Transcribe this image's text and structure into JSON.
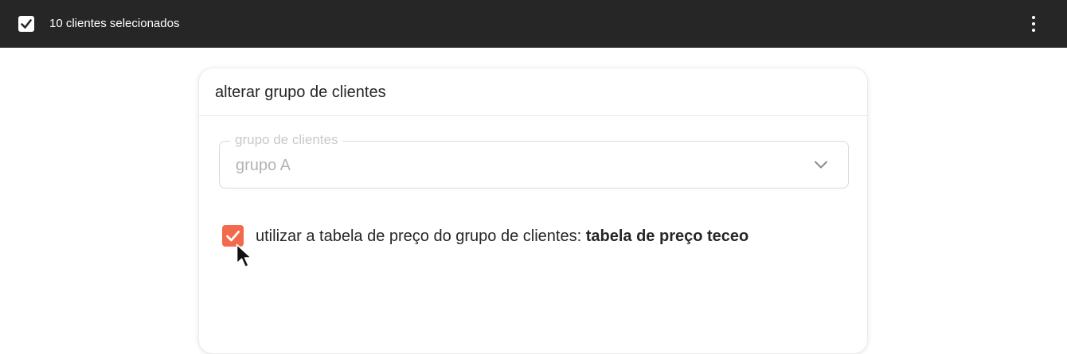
{
  "topbar": {
    "title": "10 clientes selecionados",
    "selected_checked": true,
    "menu_icon": "kebab-menu-icon"
  },
  "dialog": {
    "title": "alterar grupo de clientes",
    "group_field": {
      "label": "grupo de clientes",
      "value": "grupo A",
      "icon": "chevron-down-icon"
    },
    "price_table_option": {
      "checked": true,
      "label_prefix": "utilizar a tabela de preço do grupo de clientes: ",
      "label_value": "tabela de preço teceo"
    }
  },
  "colors": {
    "topbar_bg": "#262626",
    "accent": "#f26a4b"
  }
}
